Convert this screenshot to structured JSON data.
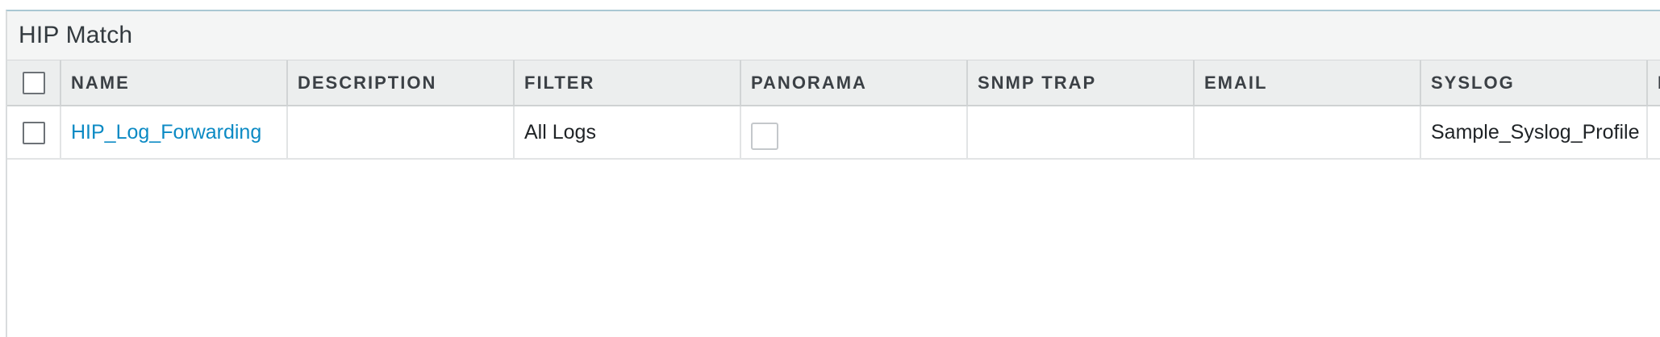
{
  "panel": {
    "title": "HIP Match"
  },
  "table": {
    "columns": [
      "NAME",
      "DESCRIPTION",
      "FILTER",
      "PANORAMA",
      "SNMP TRAP",
      "EMAIL",
      "SYSLOG",
      "H"
    ],
    "rows": [
      {
        "name": "HIP_Log_Forwarding",
        "description": "",
        "filter": "All Logs",
        "panorama": false,
        "snmp_trap": "",
        "email": "",
        "syslog": "Sample_Syslog_Profile",
        "extra": ""
      }
    ]
  },
  "colors": {
    "link": "#0b8ac4",
    "header_bg": "#eceeee",
    "panel_header_bg": "#f4f5f5",
    "accent_border": "#a9c7d3"
  }
}
